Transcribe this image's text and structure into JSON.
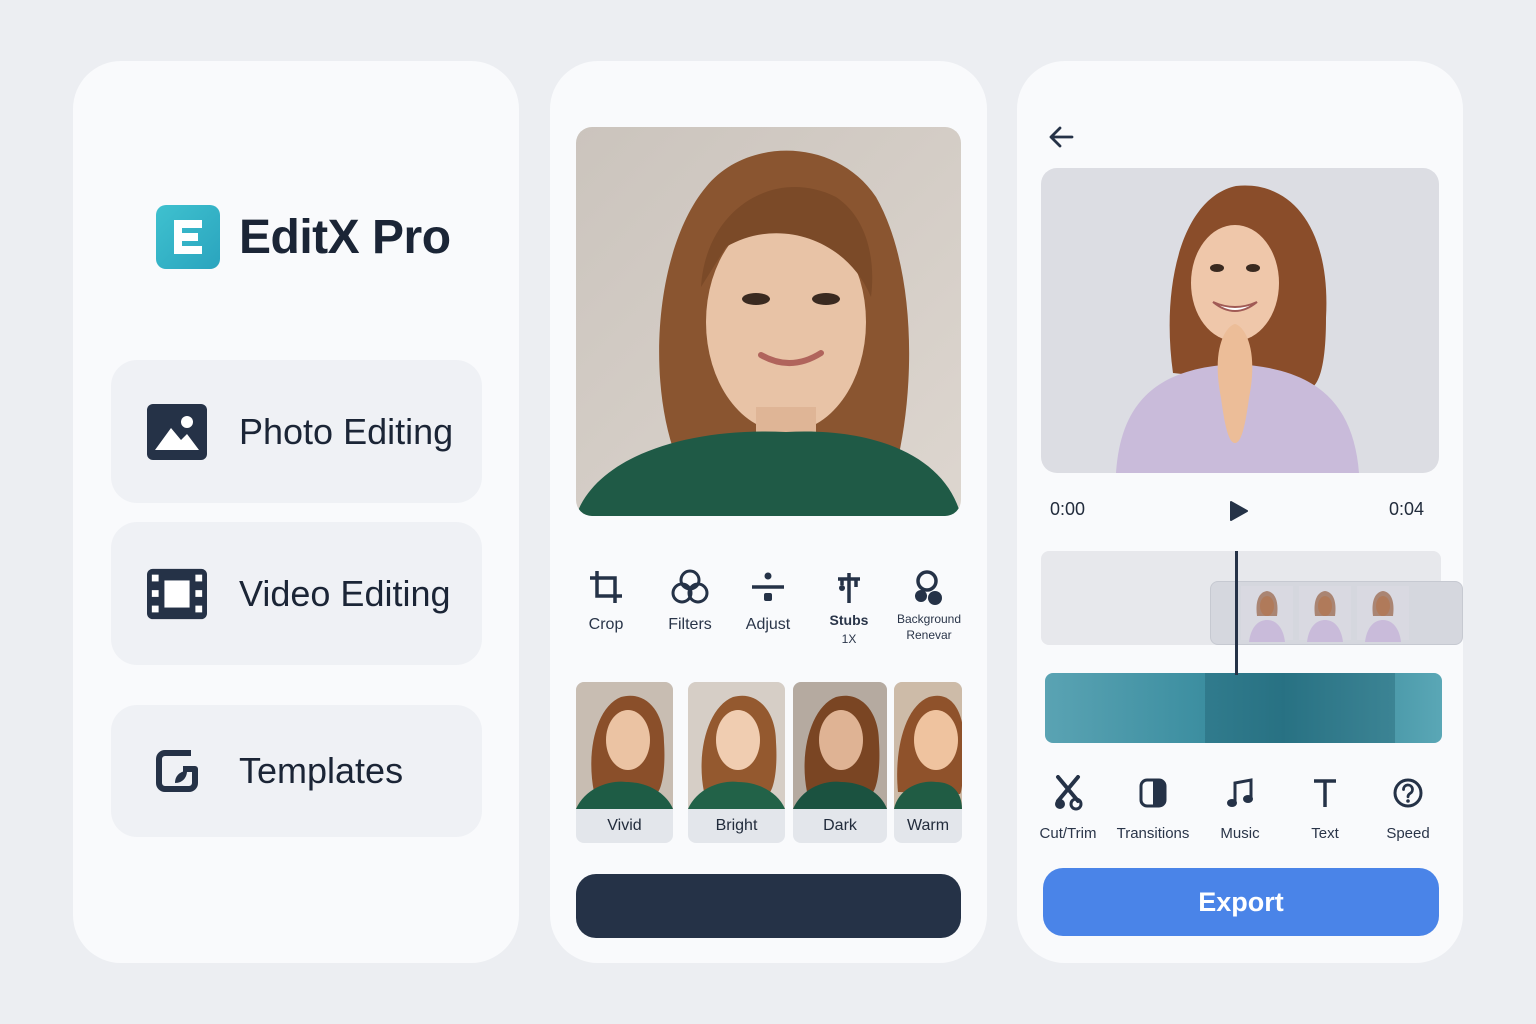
{
  "colors": {
    "page_bg": "#eceef2",
    "card_bg": "#f9fafc",
    "brand_teal": "#32b4c6",
    "navy": "#253247",
    "export_blue": "#4a84e8",
    "menu_card_bg": "#eff1f5"
  },
  "home": {
    "logo_letter": "E",
    "app_title": "EditX Pro",
    "menu": [
      {
        "label": "Photo Editing",
        "icon": "image-icon"
      },
      {
        "label": "Video Editing",
        "icon": "film-icon"
      },
      {
        "label": "Templates",
        "icon": "template-icon"
      }
    ]
  },
  "photo_editor": {
    "tools": [
      {
        "label": "Crop",
        "icon": "crop-icon"
      },
      {
        "label": "Filters",
        "icon": "filters-icon"
      },
      {
        "label": "Adjust",
        "icon": "adjust-icon"
      },
      {
        "label": "Stubs",
        "sublabel": "1X",
        "icon": "stubs-icon"
      },
      {
        "label": "Background",
        "sublabel": "Renevar",
        "icon": "background-icon"
      }
    ],
    "filters": [
      {
        "label": "Vivid"
      },
      {
        "label": "Bright"
      },
      {
        "label": "Dark"
      },
      {
        "label": "Warm"
      }
    ]
  },
  "video_editor": {
    "time_start": "0:00",
    "time_end": "0:04",
    "playhead_progress": 0.49,
    "tools": [
      {
        "label": "Cut/Trim",
        "icon": "scissors-icon"
      },
      {
        "label": "Transitions",
        "icon": "transitions-icon"
      },
      {
        "label": "Music",
        "icon": "music-note-icon"
      },
      {
        "label": "Text",
        "icon": "text-icon"
      },
      {
        "label": "Speed",
        "icon": "speed-icon"
      }
    ],
    "export_label": "Export"
  }
}
